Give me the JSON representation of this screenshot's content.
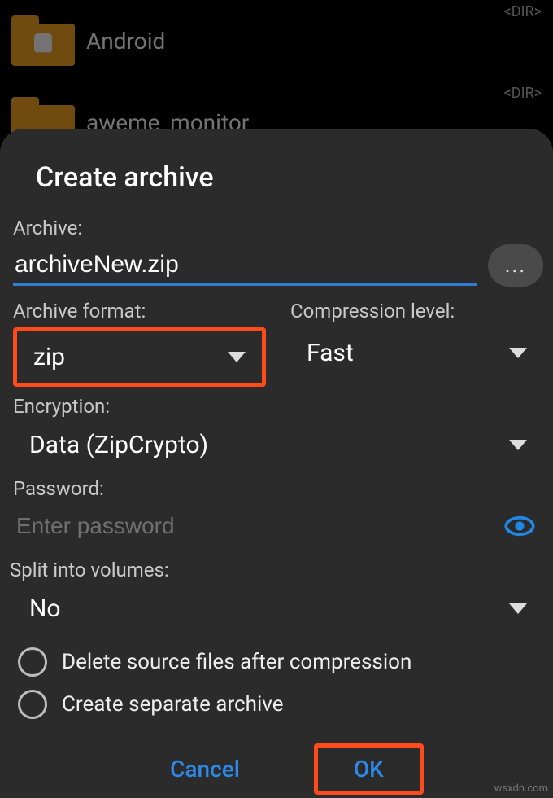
{
  "background": {
    "items": [
      {
        "name": "Android",
        "dirTag": "<DIR>"
      },
      {
        "name": "aweme_monitor",
        "dirTag": "<DIR>"
      }
    ]
  },
  "dialog": {
    "title": "Create archive",
    "archive": {
      "label": "Archive:",
      "value": "archiveNew.zip",
      "moreLabel": "..."
    },
    "format": {
      "label": "Archive format:",
      "value": "zip"
    },
    "compression": {
      "label": "Compression level:",
      "value": "Fast"
    },
    "encryption": {
      "label": "Encryption:",
      "value": "Data (ZipCrypto)"
    },
    "password": {
      "label": "Password:",
      "placeholder": "Enter password"
    },
    "split": {
      "label": "Split into volumes:",
      "value": "No"
    },
    "options": {
      "deleteSource": "Delete source files after compression",
      "separateArchive": "Create separate archive"
    },
    "buttons": {
      "cancel": "Cancel",
      "ok": "OK"
    }
  },
  "watermark": "wsxdn.com"
}
